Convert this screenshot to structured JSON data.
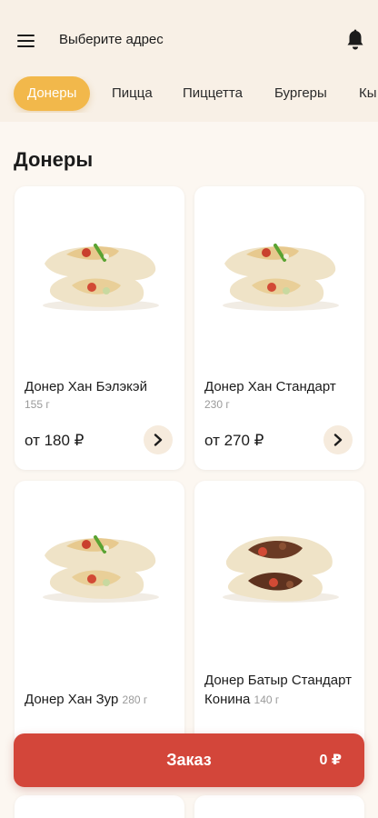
{
  "header": {
    "address_label": "Выберите адрес",
    "menu_icon": "menu-icon",
    "bell_icon": "bell-icon"
  },
  "categories": [
    {
      "label": "Донеры",
      "active": true
    },
    {
      "label": "Пицца",
      "active": false
    },
    {
      "label": "Пиццетта",
      "active": false
    },
    {
      "label": "Бургеры",
      "active": false
    },
    {
      "label": "Кы",
      "active": false
    }
  ],
  "section": {
    "title": "Донеры"
  },
  "products": [
    {
      "name": "Донер Хан Бэлэкэй",
      "weight": "155 г",
      "price": "от 180 ₽",
      "filling": "chicken"
    },
    {
      "name": "Донер Хан Стандарт",
      "weight": "230 г",
      "price": "от 270 ₽",
      "filling": "chicken"
    },
    {
      "name": "Донер Хан Зур",
      "weight": "280 г",
      "price": "",
      "filling": "chicken"
    },
    {
      "name": "Донер Батыр Стандарт Конина",
      "weight": "140 г",
      "price": "",
      "filling": "beef"
    }
  ],
  "order": {
    "label": "Заказ",
    "total": "0 ₽"
  },
  "colors": {
    "accent": "#F2B84B",
    "order_button": "#D3463A",
    "background": "#FCF7F1",
    "header_background": "#F8F0E6"
  }
}
